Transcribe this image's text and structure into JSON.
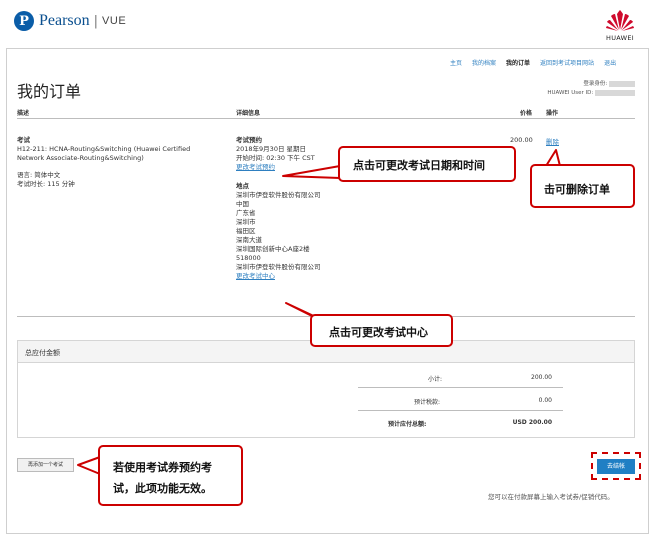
{
  "brand": {
    "logo_letter": "P",
    "name": "Pearson",
    "separator": "|",
    "product": "VUE",
    "partner": "HUAWEI"
  },
  "nav": {
    "items": [
      {
        "label": "主页",
        "active": false
      },
      {
        "label": "我的档案",
        "active": false
      },
      {
        "label": "我的订单",
        "active": true
      },
      {
        "label": "返回到考试项目网站",
        "active": false
      },
      {
        "label": "退出",
        "active": false
      }
    ]
  },
  "page": {
    "title": "我的订单",
    "login_label": "登录身份:",
    "user_id_label": "HUAWEI User ID:"
  },
  "table": {
    "headers": {
      "description": "描述",
      "details": "详细信息",
      "price": "价格",
      "actions": "操作"
    },
    "order": {
      "type": "考试",
      "exam_name": "H12-211: HCNA-Routing&Switching (Huawei Certified Network Associate-Routing&Switching)",
      "language": "语言: 简体中文",
      "duration": "考试时长: 115 分钟",
      "appointment_title": "考试预约",
      "appointment_date": "2018年9月30日 星期日",
      "appointment_time": "开始时间: 02:30 下午 CST",
      "change_appointment": "更改考试预约",
      "location_title": "地点",
      "location_lines": [
        "深圳市伊登软件股份有限公司",
        "中国",
        "广东省",
        "深圳市",
        "福田区",
        "深南大道",
        "深圳国际创新中心A座2楼",
        "518000",
        "深圳市伊登软件股份有限公司"
      ],
      "change_center": "更改考试中心",
      "price": "200.00",
      "remove": "删除"
    }
  },
  "summary": {
    "title": "总应付金额",
    "subtotal_label": "小计:",
    "subtotal_value": "200.00",
    "tax_label": "预计税款:",
    "tax_value": "0.00",
    "total_label": "预计应付总额:",
    "total_value": "USD 200.00"
  },
  "actions": {
    "add_exam": "再添加一个考试",
    "checkout": "去结帐"
  },
  "footnote": "您可以在付款屏幕上输入考试券/促销代码。",
  "callouts": {
    "change_time": "点击可更改考试日期和时间",
    "delete_order_1": "击可删除订单",
    "change_center": "点击可更改考试中心",
    "voucher_note": "若使用考试券预约考试，此项功能无效。"
  },
  "colors": {
    "link": "#2e7fc0",
    "callout_border": "#cc0000",
    "checkout": "#1f7fc4",
    "brand_blue": "#0a5da8",
    "huawei_red": "#cf0a2c"
  }
}
